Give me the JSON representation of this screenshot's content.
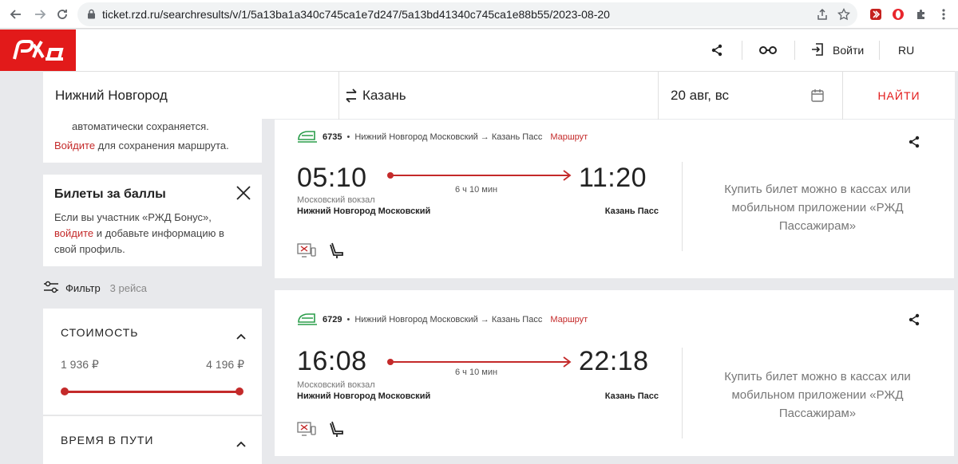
{
  "browser": {
    "url": "ticket.rzd.ru/searchresults/v/1/5a13ba1a340c745ca1e7d247/5a13bd41340c745ca1e88b55/2023-08-20"
  },
  "header": {
    "logo_text": "РЖД",
    "login_label": "Войти",
    "lang_label": "RU"
  },
  "search": {
    "from": "Нижний Новгород",
    "to": "Казань",
    "date": "20 авг, вс",
    "find_label": "НАЙТИ"
  },
  "sidebar": {
    "save_note": "автоматически сохраняется.",
    "login_link": "Войдите",
    "login_rest": " для сохранения маршрута.",
    "bonus": {
      "title": "Билеты за баллы",
      "text_1": "Если вы участник «РЖД Бонус»,",
      "link": "войдите",
      "text_2": " и добавьте информацию в свой профиль."
    },
    "filter": {
      "label": "Фильтр",
      "count": "3 рейса"
    },
    "cost": {
      "title": "СТОИМОСТЬ",
      "min": "1 936 ₽",
      "max": "4 196 ₽"
    },
    "travel_time": {
      "title": "ВРЕМЯ В ПУТИ"
    }
  },
  "trains": [
    {
      "number": "6735",
      "route": "Нижний Новгород Московский → Казань Пасс",
      "route_link": "Маршрут",
      "dep_time": "05:10",
      "arr_time": "11:20",
      "duration": "6 ч 10 мин",
      "dep_station_sub": "Московский вокзал",
      "dep_station": "Нижний Новгород Московский",
      "arr_station": "Казань Пасс",
      "buy_text": "Купить билет можно в кассах или мобильном приложении «РЖД Пассажирам»"
    },
    {
      "number": "6729",
      "route": "Нижний Новгород Московский → Казань Пасс",
      "route_link": "Маршрут",
      "dep_time": "16:08",
      "arr_time": "22:18",
      "duration": "6 ч 10 мин",
      "dep_station_sub": "Московский вокзал",
      "dep_station": "Нижний Новгород Московский",
      "arr_station": "Казань Пасс",
      "buy_text": "Купить билет можно в кассах или мобильном приложении «РЖД Пассажирам»"
    }
  ],
  "colors": {
    "brand_red": "#e21a1a",
    "link_red": "#c42a2a",
    "train_green": "#2a9d4a"
  },
  "icons": [
    "back-icon",
    "forward-icon",
    "reload-icon",
    "lock-icon",
    "share-icon",
    "star-icon",
    "extension-icon",
    "opera-icon",
    "puzzle-icon",
    "menu-icon",
    "glasses-icon",
    "login-icon",
    "swap-icon",
    "calendar-icon",
    "close-icon",
    "filter-icon",
    "chevron-up-icon",
    "train-icon",
    "no-electronic-registration-icon",
    "seat-icon"
  ]
}
